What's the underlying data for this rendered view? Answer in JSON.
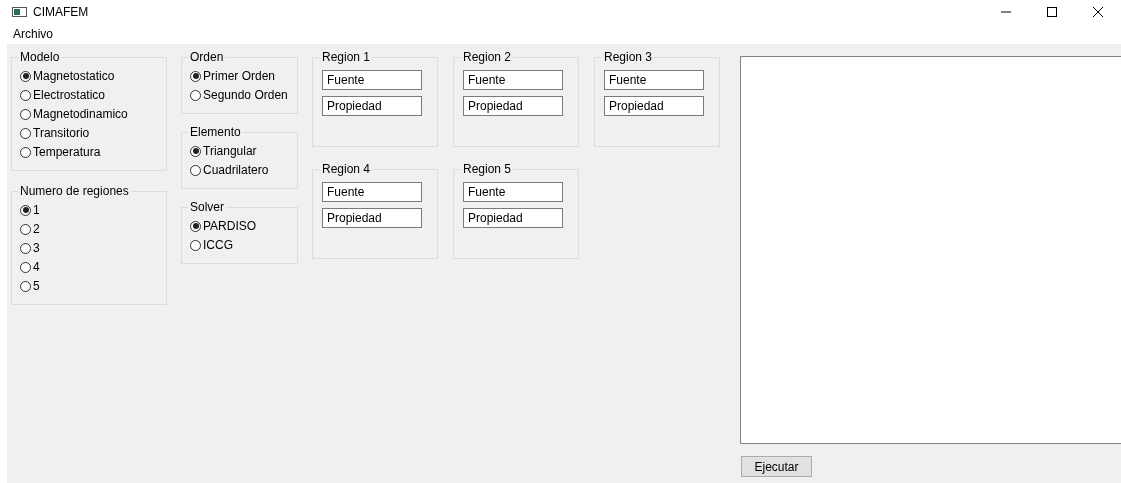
{
  "window": {
    "title": "CIMAFEM"
  },
  "menu": [
    "Archivo"
  ],
  "columns": [
    [
      {
        "title": "Modelo",
        "options": [
          {
            "label": "Magnetostatico",
            "selected": true
          },
          {
            "label": "Electrostatico",
            "selected": false
          },
          {
            "label": "Magnetodinamico",
            "selected": false
          },
          {
            "label": "Transitorio",
            "selected": false
          },
          {
            "label": "Temperatura",
            "selected": false
          }
        ]
      },
      {
        "title": "Numero de regiones",
        "options": [
          {
            "label": "1",
            "selected": true
          },
          {
            "label": "2",
            "selected": false
          },
          {
            "label": "3",
            "selected": false
          },
          {
            "label": "4",
            "selected": false
          },
          {
            "label": "5",
            "selected": false
          }
        ]
      }
    ],
    [
      {
        "title": "Orden",
        "options": [
          {
            "label": "Primer Orden",
            "selected": true
          },
          {
            "label": "Segundo Orden",
            "selected": false
          }
        ]
      },
      {
        "title": "Elemento",
        "options": [
          {
            "label": "Triangular",
            "selected": true
          },
          {
            "label": "Cuadrilatero",
            "selected": false
          }
        ]
      },
      {
        "title": "Solver",
        "options": [
          {
            "label": "PARDISO",
            "selected": true
          },
          {
            "label": "ICCG",
            "selected": false
          }
        ]
      }
    ]
  ],
  "regions": [
    {
      "title": "Region 1",
      "fields": [
        "Fuente",
        "Propiedad"
      ]
    },
    {
      "title": "Region 2",
      "fields": [
        "Fuente",
        "Propiedad"
      ]
    },
    {
      "title": "Region 3",
      "fields": [
        "Fuente",
        "Propiedad"
      ]
    },
    {
      "title": "Region 4",
      "fields": [
        "Fuente",
        "Propiedad"
      ]
    },
    {
      "title": "Region 5",
      "fields": [
        "Fuente",
        "Propiedad"
      ]
    }
  ],
  "run_button": "Ejecutar"
}
